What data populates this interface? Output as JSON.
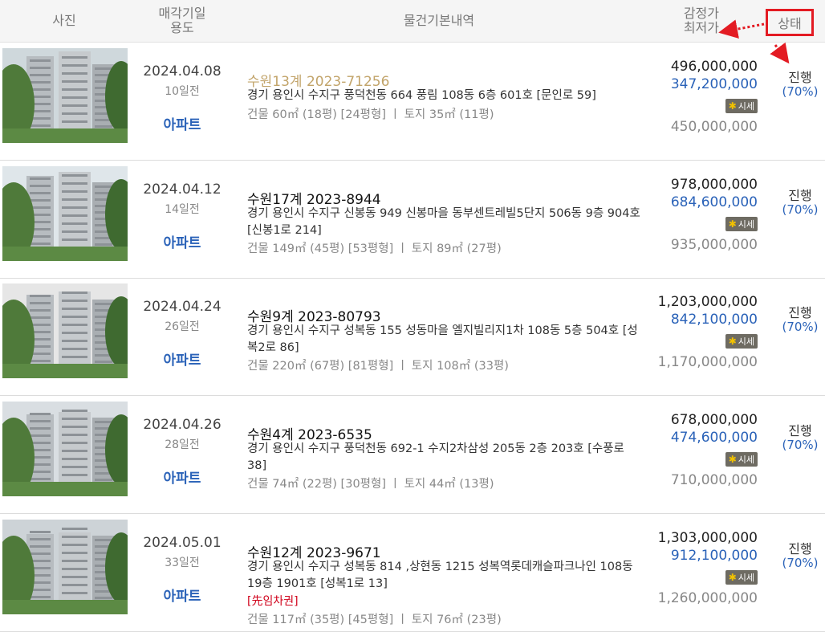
{
  "header": {
    "photo": "사진",
    "date_line1": "매각기일",
    "date_line2": "용도",
    "basic": "물건기본내역",
    "price_line1": "감정가",
    "price_line2": "최저가",
    "status": "상태"
  },
  "badge_label": "시세",
  "rows": [
    {
      "date": "2024.04.08",
      "days_ago": "10일전",
      "type": "아파트",
      "case_no": "수원13계 2023-71256",
      "address": "경기 용인시 수지구 풍덕천동 664 풍림 108동 6층 601호 [문인로 59]",
      "tag": "",
      "area": "건물 60㎡ (18평) [24평형]  ㅣ  토지 35㎡ (11평)",
      "appraisal": "496,000,000",
      "minimum": "347,200,000",
      "market": "450,000,000",
      "status": "진행",
      "rate": "(70%)"
    },
    {
      "date": "2024.04.12",
      "days_ago": "14일전",
      "type": "아파트",
      "case_no": "수원17계 2023-8944",
      "address": "경기 용인시 수지구 신봉동 949 신봉마을 동부센트레빌5단지 506동 9층 904호 [신봉1로 214]",
      "tag": "",
      "area": "건물 149㎡ (45평) [53평형]  ㅣ  토지 89㎡ (27평)",
      "appraisal": "978,000,000",
      "minimum": "684,600,000",
      "market": "935,000,000",
      "status": "진행",
      "rate": "(70%)"
    },
    {
      "date": "2024.04.24",
      "days_ago": "26일전",
      "type": "아파트",
      "case_no": "수원9계 2023-80793",
      "address": "경기 용인시 수지구 성복동 155 성동마을 엘지빌리지1차 108동 5층 504호 [성복2로 86]",
      "tag": "",
      "area": "건물 220㎡ (67평) [81평형]  ㅣ  토지 108㎡ (33평)",
      "appraisal": "1,203,000,000",
      "minimum": "842,100,000",
      "market": "1,170,000,000",
      "status": "진행",
      "rate": "(70%)"
    },
    {
      "date": "2024.04.26",
      "days_ago": "28일전",
      "type": "아파트",
      "case_no": "수원4계 2023-6535",
      "address": "경기 용인시 수지구 풍덕천동 692-1 수지2차삼성 205동 2층 203호 [수풍로 38]",
      "tag": "",
      "area": "건물 74㎡ (22평) [30평형]  ㅣ  토지 44㎡ (13평)",
      "appraisal": "678,000,000",
      "minimum": "474,600,000",
      "market": "710,000,000",
      "status": "진행",
      "rate": "(70%)"
    },
    {
      "date": "2024.05.01",
      "days_ago": "33일전",
      "type": "아파트",
      "case_no": "수원12계 2023-9671",
      "address": "경기 용인시 수지구 성복동 814 ,상현동 1215 성복역롯데캐슬파크나인 108동 19층 1901호 [성복1로 13]",
      "tag": "[先임차권]",
      "area": "건물 117㎡ (35평) [45평형]  ㅣ  토지 76㎡ (23평)",
      "appraisal": "1,303,000,000",
      "minimum": "912,100,000",
      "market": "1,260,000,000",
      "status": "진행",
      "rate": "(70%)"
    }
  ]
}
